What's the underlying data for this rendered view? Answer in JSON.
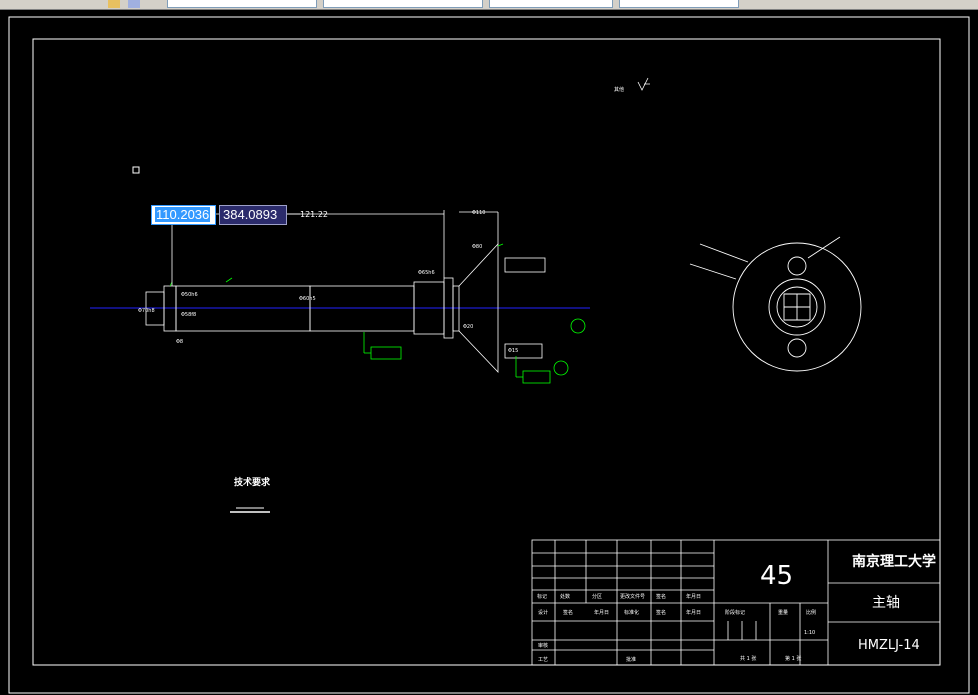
{
  "toolbar": {
    "items": [
      "",
      "",
      "",
      ""
    ]
  },
  "dynamic_input": {
    "x_value": "110.2036",
    "y_value": "384.0893",
    "tracking_value": "121.22"
  },
  "drawing": {
    "surface_note": "其他",
    "section_label": "技术要求",
    "dims": {
      "d1": "Φ70h8",
      "d2": "Φ50h6",
      "d3": "Φ58f8",
      "d4": "Φ60h5",
      "d5": "Φ65h6",
      "d6": "Φ110",
      "d7": "Φ80",
      "d8": "Φ20",
      "d9": "Φ15",
      "d10": "Φ8"
    }
  },
  "title_block": {
    "material": "45",
    "school": "南京理工大学",
    "part_name": "主轴",
    "drawing_no": "HMZLJ-14",
    "row_labels": [
      "标记",
      "处数",
      "分区",
      "更改文件号",
      "签名",
      "年月日"
    ],
    "row_labels2": [
      "设计",
      "签名",
      "年月日",
      "标准化",
      "签名",
      "年月日"
    ],
    "review": "审核",
    "process": "工艺",
    "approve": "批准",
    "stage_label": "阶段标记",
    "weight_label": "重量",
    "scale_label": "比例",
    "scale_value": "1:10",
    "sheets": "共 1 张",
    "sheet_no": "第 1 张"
  }
}
